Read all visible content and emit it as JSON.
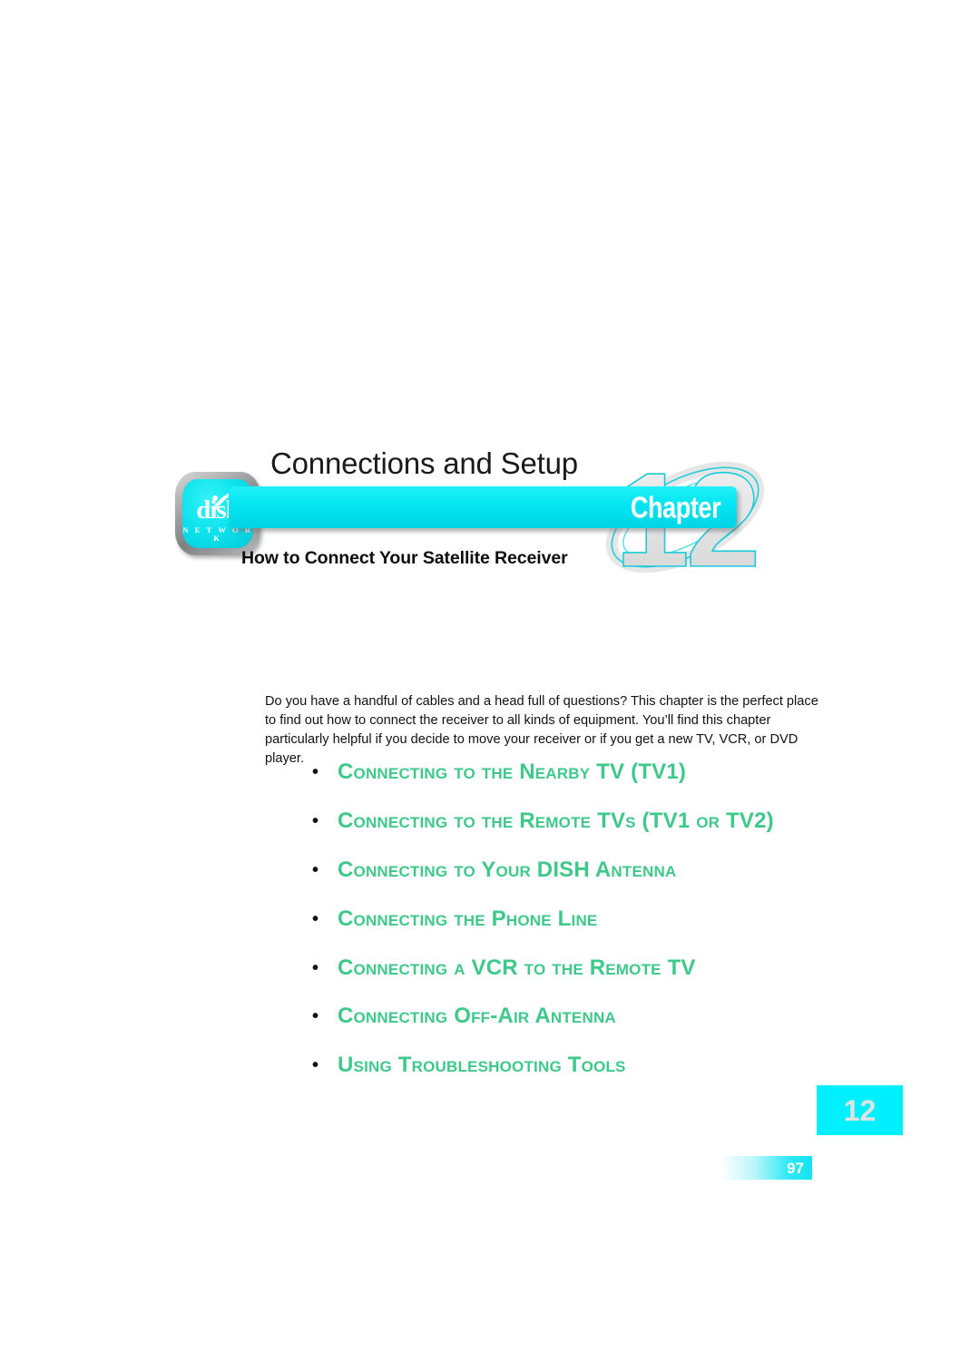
{
  "document": {
    "chapter_title": "Connections and Setup",
    "chapter_word": "Chapter",
    "chapter_number": "12",
    "subtitle": "How to Connect Your Satellite Receiver",
    "page_number": "97"
  },
  "logo": {
    "wordmark": "dish",
    "sub_wordmark": "N E T W O R K"
  },
  "intro": {
    "paragraph": "Do you have a handful of cables and a head full of questions? This chapter is the perfect place to find out how to connect the receiver to all kinds of equipment. You’ll find this chapter particularly helpful if you decide to move your receiver or if you get a new TV, VCR, or DVD player."
  },
  "topics": [
    {
      "label": "Connecting to the Nearby TV (TV1)"
    },
    {
      "label": "Connecting to the Remote TVs (TV1 or TV2)"
    },
    {
      "label": "Connecting to Your DISH Antenna"
    },
    {
      "label": "Connecting the Phone Line"
    },
    {
      "label": "Connecting a VCR to the Remote TV"
    },
    {
      "label": "Connecting Off-Air Antenna"
    },
    {
      "label": "Using Troubleshooting Tools"
    }
  ],
  "colors": {
    "cyan_bar": "#04e6f1",
    "tab_cyan": "#00f0ff",
    "topic_green": "#3ec88a",
    "watermark_gray": "#e3e3e3",
    "watermark_outline": "#15c9d6"
  }
}
